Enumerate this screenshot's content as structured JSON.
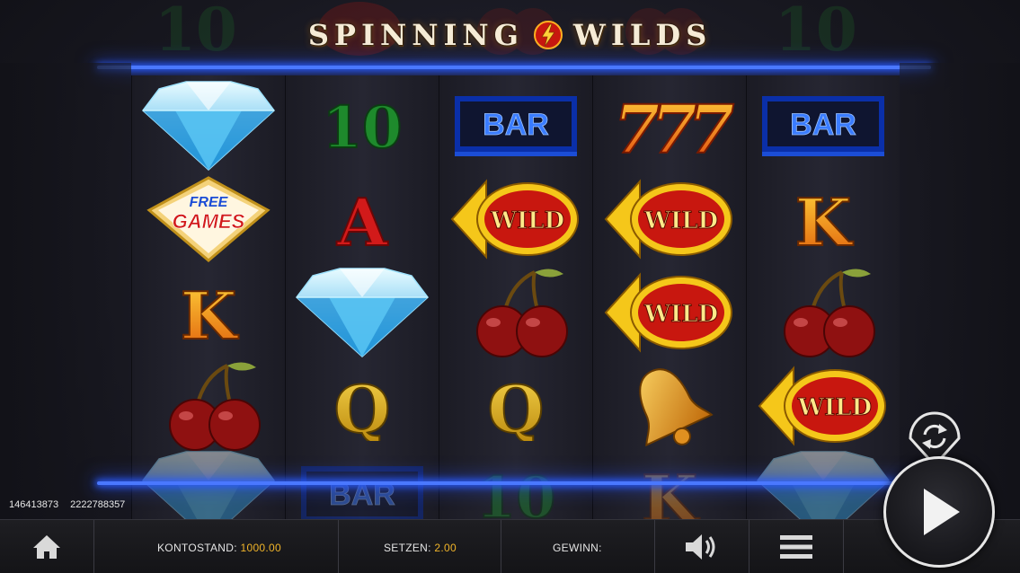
{
  "game": {
    "title_left": "SPINNING",
    "title_right": "WILDS"
  },
  "colors": {
    "neon": "#4a78ff",
    "accent_value": "#f0b429",
    "bar_blue": "#1b4dd6",
    "ten_green": "#1f7d2b",
    "wild_red": "#c8170f",
    "wild_yellow": "#f5c71a"
  },
  "ghost_symbols_top": [
    "10",
    "seven",
    "cherry",
    "cherry",
    "10"
  ],
  "reels": [
    {
      "symbols": [
        "diamond",
        "free-games",
        "king",
        "cherry"
      ],
      "partial_below": "diamond"
    },
    {
      "symbols": [
        "ten",
        "ace",
        "diamond",
        "queen"
      ],
      "partial_below": "bar"
    },
    {
      "symbols": [
        "bar",
        "wild",
        "cherry",
        "queen"
      ],
      "partial_below": "ten"
    },
    {
      "symbols": [
        "seven",
        "wild",
        "wild",
        "bell"
      ],
      "partial_below": "king"
    },
    {
      "symbols": [
        "bar",
        "king",
        "cherry",
        "wild"
      ],
      "partial_below": "diamond"
    }
  ],
  "symbol_text": {
    "bar": "BAR",
    "ten": "10",
    "ace": "A",
    "king": "K",
    "queen": "Q",
    "wild": "WILD",
    "free_line1": "FREE",
    "free_line2": "GAMES",
    "seven": "777"
  },
  "ids": {
    "left": "146413873",
    "right": "2222788357"
  },
  "bottom_bar": {
    "balance_label": "KONTOSTAND:",
    "balance_value": "1000.00",
    "bet_label": "SETZEN:",
    "bet_value": "2.00",
    "win_label": "GEWINN:",
    "win_value": ""
  },
  "icons": {
    "home": "home-icon",
    "sound": "speaker-icon",
    "menu": "hamburger-menu-icon",
    "spin": "play-icon",
    "autoplay": "refresh-icon"
  }
}
